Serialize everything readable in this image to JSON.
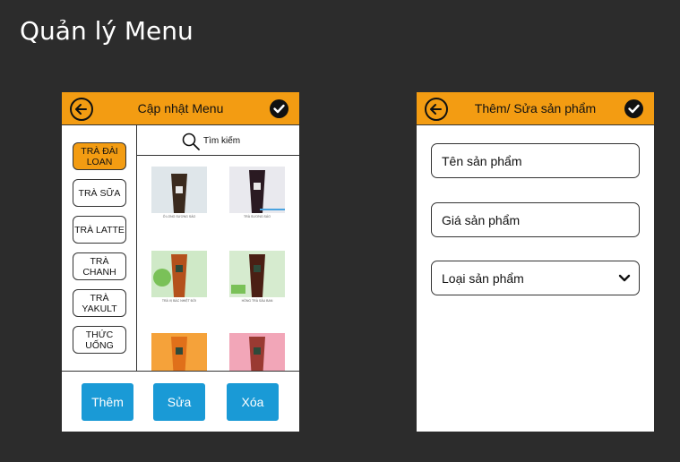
{
  "page": {
    "title": "Quản lý Menu"
  },
  "menu_screen": {
    "header": {
      "title": "Cập nhật Menu"
    },
    "search": {
      "label": "Tìm kiếm"
    },
    "categories": [
      {
        "label": "TRÀ ĐÀI LOAN",
        "active": true
      },
      {
        "label": "TRÀ SỮA",
        "active": false
      },
      {
        "label": "TRÀ LATTE",
        "active": false
      },
      {
        "label": "TRÀ CHANH",
        "active": false
      },
      {
        "label": "TRÀ YAKULT",
        "active": false
      },
      {
        "label": "THỨC UỐNG",
        "active": false
      }
    ],
    "products": [
      {
        "caption": "Ô LONG SƯƠNG SÁO",
        "drink_color": "#3a2a1e",
        "bg": "#dfe6ea"
      },
      {
        "caption": "TRÀ SƯƠNG SÁO",
        "drink_color": "#2a1a22",
        "bg": "#e9e9ee"
      },
      {
        "caption": "TRÀ VỊ BÁC NHIỆT ĐỚI",
        "drink_color": "#b4511c",
        "bg": "#cfe9c7"
      },
      {
        "caption": "HỒNG TRÀ SÂU BAN",
        "drink_color": "#4a1f14",
        "bg": "#d6ebcf"
      },
      {
        "caption": "",
        "drink_color": "#e0701a",
        "bg": "#f5a23a"
      },
      {
        "caption": "",
        "drink_color": "#9a3a32",
        "bg": "#f2a6b8"
      }
    ],
    "actions": {
      "add": "Thêm",
      "edit": "Sửa",
      "delete": "Xóa"
    }
  },
  "product_form_screen": {
    "header": {
      "title": "Thêm/ Sửa sản phẩm"
    },
    "fields": {
      "name_placeholder": "Tên sản phẩm",
      "price_placeholder": "Giá sản phẩm",
      "category_value": "Loại sản phẩm"
    }
  },
  "colors": {
    "accent": "#f39c12",
    "button": "#1a9ad6",
    "background": "#2c2c2c"
  }
}
